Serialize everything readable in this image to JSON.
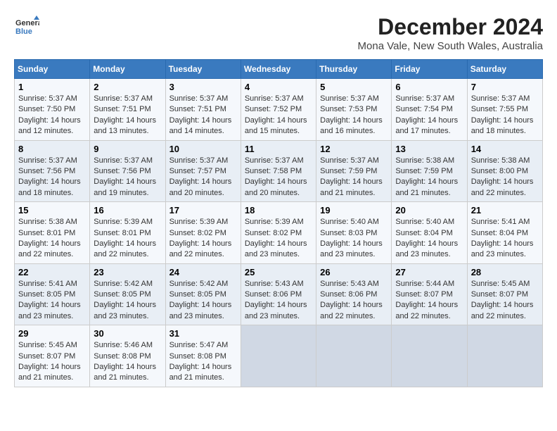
{
  "header": {
    "logo_line1": "General",
    "logo_line2": "Blue",
    "title": "December 2024",
    "subtitle": "Mona Vale, New South Wales, Australia"
  },
  "calendar": {
    "headers": [
      "Sunday",
      "Monday",
      "Tuesday",
      "Wednesday",
      "Thursday",
      "Friday",
      "Saturday"
    ],
    "weeks": [
      [
        {
          "day": "1",
          "sunrise": "5:37 AM",
          "sunset": "7:50 PM",
          "daylight": "14 hours and 12 minutes."
        },
        {
          "day": "2",
          "sunrise": "5:37 AM",
          "sunset": "7:51 PM",
          "daylight": "14 hours and 13 minutes."
        },
        {
          "day": "3",
          "sunrise": "5:37 AM",
          "sunset": "7:51 PM",
          "daylight": "14 hours and 14 minutes."
        },
        {
          "day": "4",
          "sunrise": "5:37 AM",
          "sunset": "7:52 PM",
          "daylight": "14 hours and 15 minutes."
        },
        {
          "day": "5",
          "sunrise": "5:37 AM",
          "sunset": "7:53 PM",
          "daylight": "14 hours and 16 minutes."
        },
        {
          "day": "6",
          "sunrise": "5:37 AM",
          "sunset": "7:54 PM",
          "daylight": "14 hours and 17 minutes."
        },
        {
          "day": "7",
          "sunrise": "5:37 AM",
          "sunset": "7:55 PM",
          "daylight": "14 hours and 18 minutes."
        }
      ],
      [
        {
          "day": "8",
          "sunrise": "5:37 AM",
          "sunset": "7:56 PM",
          "daylight": "14 hours and 18 minutes."
        },
        {
          "day": "9",
          "sunrise": "5:37 AM",
          "sunset": "7:56 PM",
          "daylight": "14 hours and 19 minutes."
        },
        {
          "day": "10",
          "sunrise": "5:37 AM",
          "sunset": "7:57 PM",
          "daylight": "14 hours and 20 minutes."
        },
        {
          "day": "11",
          "sunrise": "5:37 AM",
          "sunset": "7:58 PM",
          "daylight": "14 hours and 20 minutes."
        },
        {
          "day": "12",
          "sunrise": "5:37 AM",
          "sunset": "7:59 PM",
          "daylight": "14 hours and 21 minutes."
        },
        {
          "day": "13",
          "sunrise": "5:38 AM",
          "sunset": "7:59 PM",
          "daylight": "14 hours and 21 minutes."
        },
        {
          "day": "14",
          "sunrise": "5:38 AM",
          "sunset": "8:00 PM",
          "daylight": "14 hours and 22 minutes."
        }
      ],
      [
        {
          "day": "15",
          "sunrise": "5:38 AM",
          "sunset": "8:01 PM",
          "daylight": "14 hours and 22 minutes."
        },
        {
          "day": "16",
          "sunrise": "5:39 AM",
          "sunset": "8:01 PM",
          "daylight": "14 hours and 22 minutes."
        },
        {
          "day": "17",
          "sunrise": "5:39 AM",
          "sunset": "8:02 PM",
          "daylight": "14 hours and 22 minutes."
        },
        {
          "day": "18",
          "sunrise": "5:39 AM",
          "sunset": "8:02 PM",
          "daylight": "14 hours and 23 minutes."
        },
        {
          "day": "19",
          "sunrise": "5:40 AM",
          "sunset": "8:03 PM",
          "daylight": "14 hours and 23 minutes."
        },
        {
          "day": "20",
          "sunrise": "5:40 AM",
          "sunset": "8:04 PM",
          "daylight": "14 hours and 23 minutes."
        },
        {
          "day": "21",
          "sunrise": "5:41 AM",
          "sunset": "8:04 PM",
          "daylight": "14 hours and 23 minutes."
        }
      ],
      [
        {
          "day": "22",
          "sunrise": "5:41 AM",
          "sunset": "8:05 PM",
          "daylight": "14 hours and 23 minutes."
        },
        {
          "day": "23",
          "sunrise": "5:42 AM",
          "sunset": "8:05 PM",
          "daylight": "14 hours and 23 minutes."
        },
        {
          "day": "24",
          "sunrise": "5:42 AM",
          "sunset": "8:05 PM",
          "daylight": "14 hours and 23 minutes."
        },
        {
          "day": "25",
          "sunrise": "5:43 AM",
          "sunset": "8:06 PM",
          "daylight": "14 hours and 23 minutes."
        },
        {
          "day": "26",
          "sunrise": "5:43 AM",
          "sunset": "8:06 PM",
          "daylight": "14 hours and 22 minutes."
        },
        {
          "day": "27",
          "sunrise": "5:44 AM",
          "sunset": "8:07 PM",
          "daylight": "14 hours and 22 minutes."
        },
        {
          "day": "28",
          "sunrise": "5:45 AM",
          "sunset": "8:07 PM",
          "daylight": "14 hours and 22 minutes."
        }
      ],
      [
        {
          "day": "29",
          "sunrise": "5:45 AM",
          "sunset": "8:07 PM",
          "daylight": "14 hours and 21 minutes."
        },
        {
          "day": "30",
          "sunrise": "5:46 AM",
          "sunset": "8:08 PM",
          "daylight": "14 hours and 21 minutes."
        },
        {
          "day": "31",
          "sunrise": "5:47 AM",
          "sunset": "8:08 PM",
          "daylight": "14 hours and 21 minutes."
        },
        null,
        null,
        null,
        null
      ]
    ]
  }
}
